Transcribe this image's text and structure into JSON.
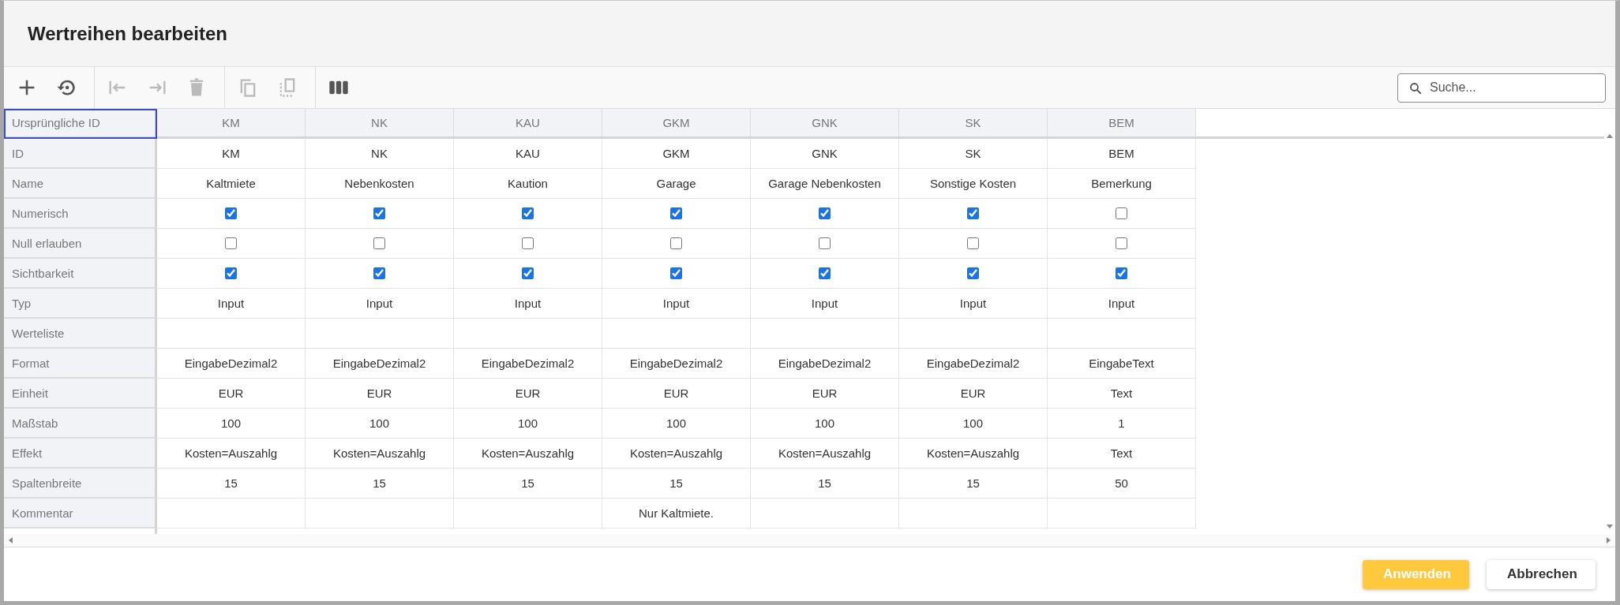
{
  "window": {
    "title": "Wertreihen bearbeiten"
  },
  "toolbar": [
    [
      {
        "kind": "add",
        "disabled": false
      },
      {
        "kind": "reset",
        "disabled": false
      }
    ],
    [
      {
        "kind": "move-left",
        "disabled": true
      },
      {
        "kind": "move-right",
        "disabled": true
      },
      {
        "kind": "delete",
        "disabled": true
      }
    ],
    [
      {
        "kind": "copy",
        "disabled": true
      },
      {
        "kind": "duplicate",
        "disabled": true
      }
    ],
    [
      {
        "kind": "columns",
        "disabled": false
      }
    ]
  ],
  "search": {
    "placeholder": "Suche..."
  },
  "table": {
    "corner": {
      "label": "Ursprüngliche ID",
      "focused": true
    },
    "columns": [
      "KM",
      "NK",
      "KAU",
      "GKM",
      "GNK",
      "SK",
      "BEM"
    ],
    "rows": [
      {
        "label": "ID",
        "kind": "text",
        "cells": [
          "KM",
          "NK",
          "KAU",
          "GKM",
          "GNK",
          "SK",
          "BEM"
        ]
      },
      {
        "label": "Name",
        "kind": "text",
        "cells": [
          "Kaltmiete",
          "Nebenkosten",
          "Kaution",
          "Garage",
          "Garage Nebenkosten",
          "Sonstige Kosten",
          "Bemerkung"
        ]
      },
      {
        "label": "Numerisch",
        "kind": "checkbox",
        "cells": [
          {
            "checked": true
          },
          {
            "checked": true
          },
          {
            "checked": true
          },
          {
            "checked": true
          },
          {
            "checked": true
          },
          {
            "checked": true
          },
          {
            "checked": false
          }
        ]
      },
      {
        "label": "Null erlauben",
        "kind": "checkbox",
        "cells": [
          {
            "checked": false
          },
          {
            "checked": false
          },
          {
            "checked": false
          },
          {
            "checked": false
          },
          {
            "checked": false
          },
          {
            "checked": false
          },
          {
            "checked": false
          }
        ]
      },
      {
        "label": "Sichtbarkeit",
        "kind": "checkbox",
        "cells": [
          {
            "checked": true
          },
          {
            "checked": true
          },
          {
            "checked": true
          },
          {
            "checked": true
          },
          {
            "checked": true
          },
          {
            "checked": true
          },
          {
            "checked": true
          }
        ]
      },
      {
        "label": "Typ",
        "kind": "text",
        "cells": [
          "Input",
          "Input",
          "Input",
          "Input",
          "Input",
          "Input",
          "Input"
        ]
      },
      {
        "label": "Werteliste",
        "kind": "text",
        "cells": [
          "",
          "",
          "",
          "",
          "",
          "",
          ""
        ]
      },
      {
        "label": "Format",
        "kind": "text",
        "cells": [
          "EingabeDezimal2",
          "EingabeDezimal2",
          "EingabeDezimal2",
          "EingabeDezimal2",
          "EingabeDezimal2",
          "EingabeDezimal2",
          "EingabeText"
        ]
      },
      {
        "label": "Einheit",
        "kind": "text",
        "cells": [
          "EUR",
          "EUR",
          "EUR",
          "EUR",
          "EUR",
          "EUR",
          "Text"
        ]
      },
      {
        "label": "Maßstab",
        "kind": "text",
        "cells": [
          "100",
          "100",
          "100",
          "100",
          "100",
          "100",
          "1"
        ]
      },
      {
        "label": "Effekt",
        "kind": "text",
        "cells": [
          "Kosten=Auszahlg",
          "Kosten=Auszahlg",
          "Kosten=Auszahlg",
          "Kosten=Auszahlg",
          "Kosten=Auszahlg",
          "Kosten=Auszahlg",
          "Text"
        ]
      },
      {
        "label": "Spaltenbreite",
        "kind": "text",
        "cells": [
          "15",
          "15",
          "15",
          "15",
          "15",
          "15",
          "50"
        ]
      },
      {
        "label": "Kommentar",
        "kind": "text",
        "cells": [
          "",
          "",
          "",
          "Nur Kaltmiete.",
          "",
          "",
          ""
        ]
      }
    ]
  },
  "buttons": [
    {
      "label": "Anwenden",
      "kind": "primary"
    },
    {
      "label": "Abbrechen",
      "kind": "secondary"
    }
  ]
}
